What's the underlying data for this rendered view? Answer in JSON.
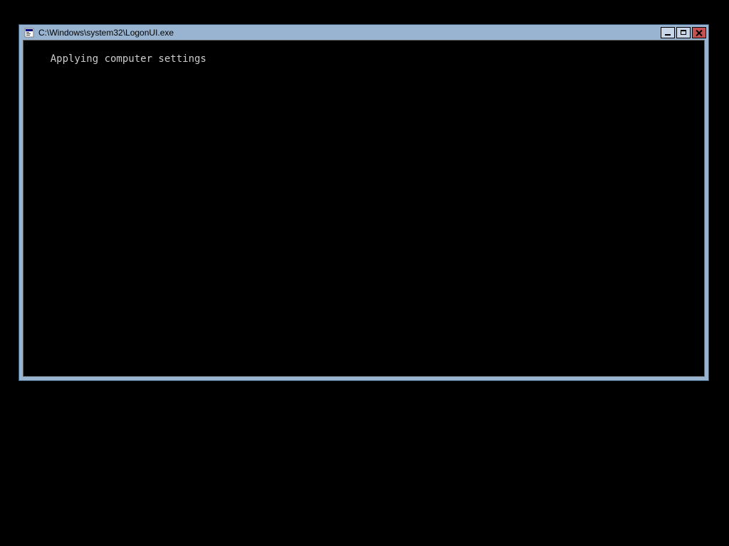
{
  "window": {
    "title": "C:\\Windows\\system32\\LogonUI.exe"
  },
  "console": {
    "output": "Applying computer settings"
  }
}
